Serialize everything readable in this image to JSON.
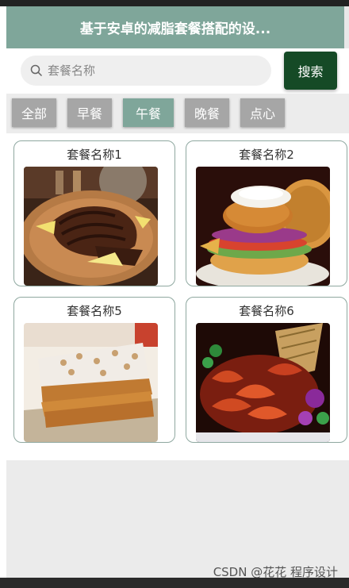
{
  "header": {
    "title": "基于安卓的减脂套餐搭配的设..."
  },
  "search": {
    "placeholder": "套餐名称",
    "button_label": "搜索"
  },
  "tabs": [
    {
      "label": "全部"
    },
    {
      "label": "早餐"
    },
    {
      "label": "午餐",
      "active": true
    },
    {
      "label": "晚餐"
    },
    {
      "label": "点心"
    }
  ],
  "meals": [
    {
      "name": "套餐名称1",
      "image": "grilled-steak-photo"
    },
    {
      "name": "套餐名称2",
      "image": "chicken-burger-photo"
    },
    {
      "name": "套餐名称5",
      "image": "puff-pastry-photo"
    },
    {
      "name": "套餐名称6",
      "image": "spicy-shrimp-photo"
    }
  ],
  "watermark": "CSDN @花花 程序设计",
  "colors": {
    "accent": "#7fa69a",
    "button": "#154a26",
    "tab": "#a6a6a6"
  }
}
